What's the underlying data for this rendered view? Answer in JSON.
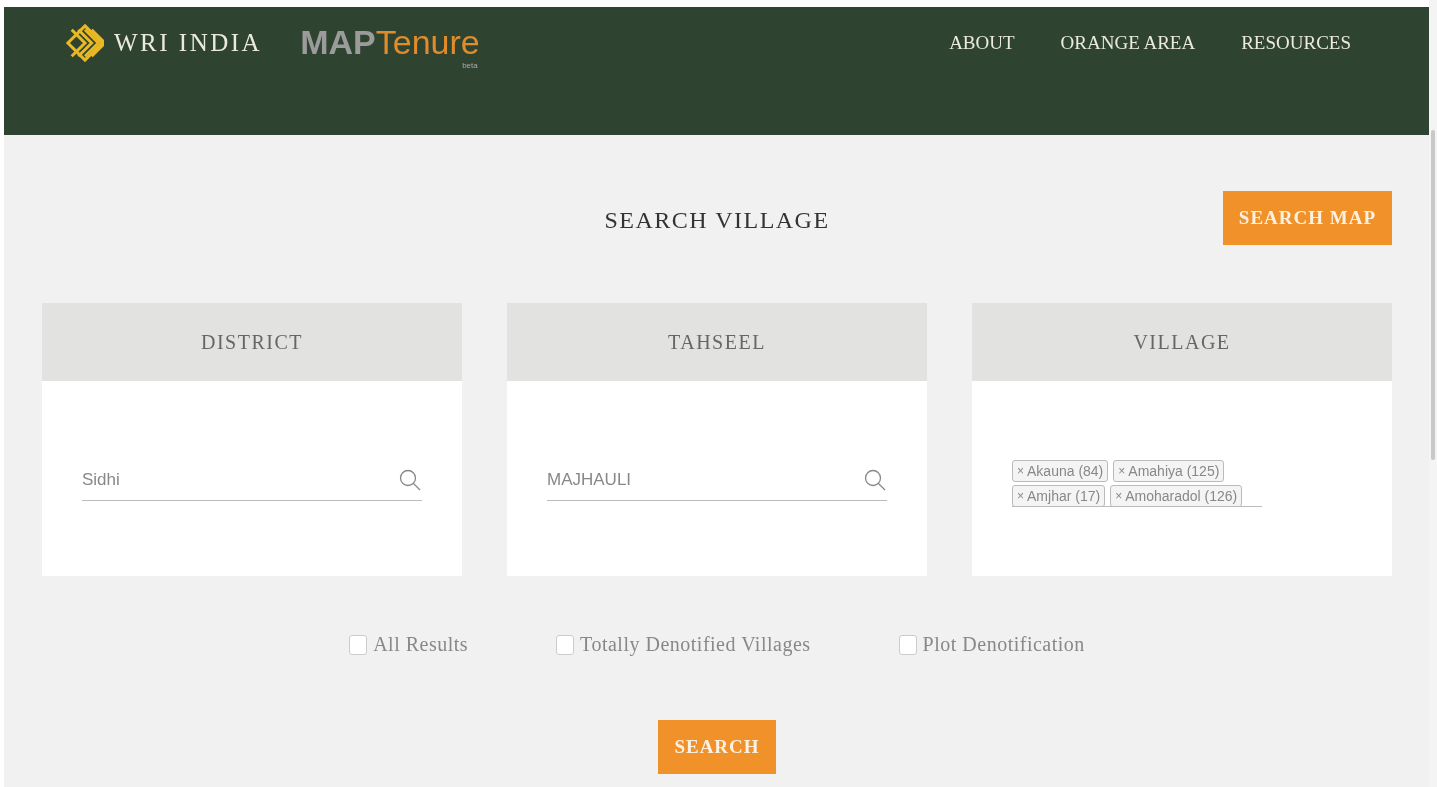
{
  "header": {
    "org": "WRI INDIA",
    "brand_part_1": "MAP",
    "brand_part_2": "Tenure",
    "badge": "beta",
    "nav": [
      "ABOUT",
      "ORANGE AREA",
      "RESOURCES"
    ]
  },
  "search_map_button": "SEARCH MAP",
  "title": "SEARCH VILLAGE",
  "panels": [
    {
      "heading": "DISTRICT",
      "kind": "field",
      "value": "Sidhi"
    },
    {
      "heading": "TAHSEEL",
      "kind": "field",
      "value": "MAJHAULI"
    },
    {
      "heading": "VILLAGE",
      "kind": "tags",
      "tags": [
        {
          "remove": "×",
          "label": "Akauna (84)"
        },
        {
          "remove": "×",
          "label": "Amahiya (125)"
        },
        {
          "remove": "×",
          "label": "Amjhar (17)"
        },
        {
          "remove": "×",
          "label": "Amoharadol (126)"
        }
      ]
    }
  ],
  "filters": [
    {
      "label": "All Results",
      "checked": false
    },
    {
      "label": "Totally Denotified Villages",
      "checked": false
    },
    {
      "label": "Plot Denotification",
      "checked": false
    }
  ],
  "search_button": "SEARCH"
}
